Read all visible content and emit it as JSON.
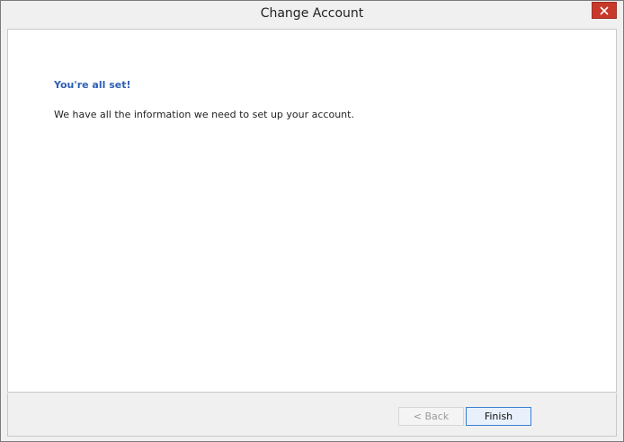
{
  "window": {
    "title": "Change Account",
    "close_icon": "close-icon"
  },
  "main": {
    "heading": "You're all set!",
    "message": "We have all the information we need to set up your account."
  },
  "footer": {
    "back_label": "< Back",
    "finish_label": "Finish"
  },
  "colors": {
    "heading": "#2e5fb4",
    "close_button": "#c7392b",
    "finish_border": "#3c7fd1"
  }
}
